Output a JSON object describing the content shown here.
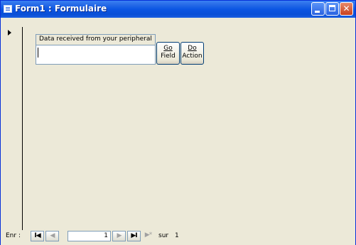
{
  "window": {
    "title": "Form1 : Formulaire",
    "titlebar_color": "#0c56e3",
    "close_color": "#c8401e",
    "controls": {
      "minimize_icon": "minimize-icon",
      "maximize_icon": "maximize-icon",
      "close_icon": "close-icon",
      "close_glyph": "✕"
    }
  },
  "form": {
    "field_label": "Data received from your peripheral",
    "field_value": "",
    "buttons": {
      "go_line1": "Go",
      "go_line2": "Field",
      "do_line1": "Do",
      "do_line2": "Action"
    }
  },
  "navigation": {
    "label": "Enr :",
    "first_glyph": "I◀",
    "prev_glyph": "◀",
    "current_record": "1",
    "next_glyph": "▶",
    "last_glyph": "▶I",
    "new_glyph": "▶*",
    "of_label": "sur",
    "total_records": "1"
  }
}
